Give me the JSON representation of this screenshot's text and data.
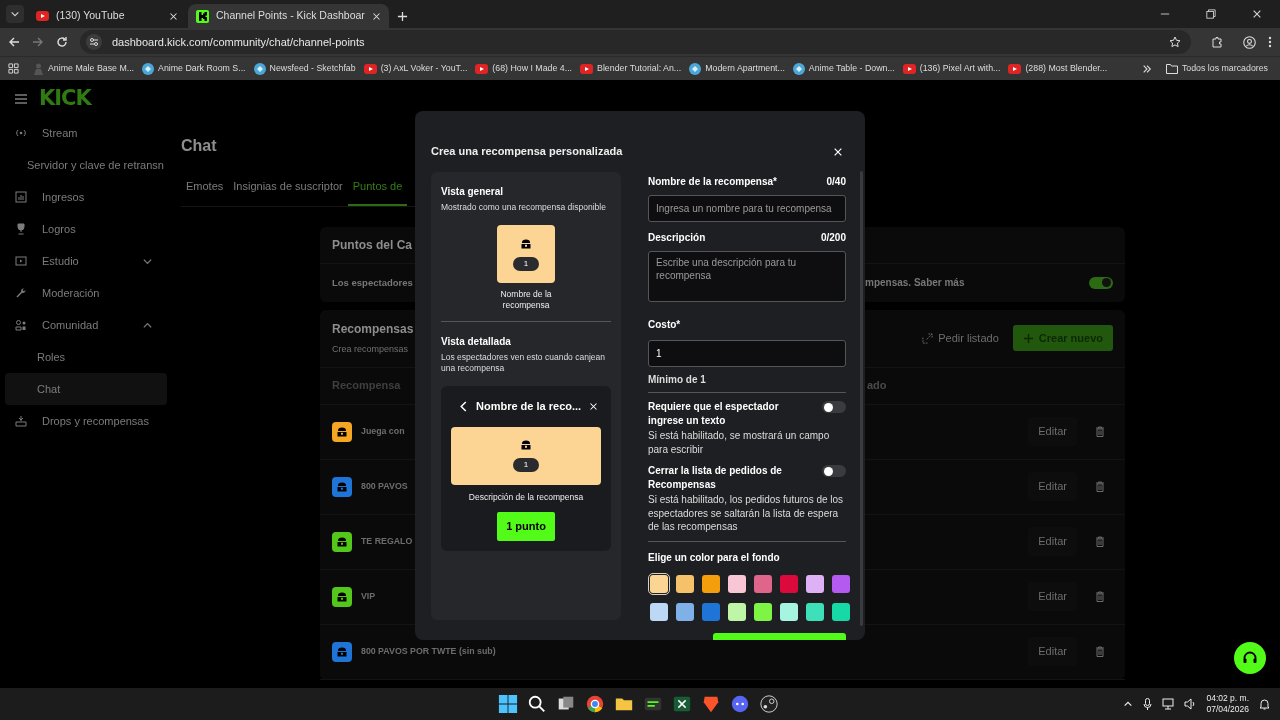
{
  "browser": {
    "tabs": [
      {
        "title": "(130) YouTube",
        "kind": "youtube",
        "selected": false
      },
      {
        "title": "Channel Points - Kick Dashboar",
        "kind": "kick",
        "selected": true
      }
    ],
    "address": "dashboard.kick.com/community/chat/channel-points",
    "bookmarks": [
      {
        "title": "Anime Male Base M...",
        "kind": "figure"
      },
      {
        "title": "Anime Dark Room S...",
        "kind": "site"
      },
      {
        "title": "Newsfeed - Sketchfab",
        "kind": "site"
      },
      {
        "title": "(3) AxL Voker - YouT...",
        "kind": "youtube"
      },
      {
        "title": "(68) How I Made 4...",
        "kind": "youtube"
      },
      {
        "title": "Blender Tutorial: An...",
        "kind": "youtube"
      },
      {
        "title": "Modern Apartment...",
        "kind": "site"
      },
      {
        "title": "Anime Table - Down...",
        "kind": "site"
      },
      {
        "title": "(136) Pixel Art with...",
        "kind": "youtube"
      },
      {
        "title": "(288) Most Blender...",
        "kind": "youtube"
      }
    ],
    "all_bookmarks": "Todos los marcadores"
  },
  "sidebar": {
    "logo": "KICK",
    "items": [
      {
        "label": "Stream",
        "selected": false,
        "children": [
          {
            "label": "Servidor y clave de retransn",
            "selected": false
          }
        ]
      },
      {
        "label": "Ingresos",
        "selected": false
      },
      {
        "label": "Logros",
        "selected": false
      },
      {
        "label": "Estudio",
        "selected": false,
        "expanded": false
      },
      {
        "label": "Moderación",
        "selected": false
      },
      {
        "label": "Comunidad",
        "selected": false,
        "expanded": true,
        "children": [
          {
            "label": "Roles",
            "selected": false
          },
          {
            "label": "Chat",
            "selected": true
          }
        ]
      },
      {
        "label": "Drops y recompensas",
        "selected": false
      }
    ]
  },
  "page": {
    "title": "Chat",
    "tabs": [
      {
        "label": "Emotes",
        "selected": false
      },
      {
        "label": "Insignias de suscriptor",
        "selected": false
      },
      {
        "label": "Puntos de",
        "selected": true
      }
    ],
    "channel_points": {
      "title": "Puntos del Ca",
      "text_left": "Los espectadores",
      "text_right": "mpensas. Saber más",
      "enabled": true
    },
    "rewards": {
      "title": "Recompensas",
      "subtitle": "Crea recompensas",
      "request_button": "Pedir listado",
      "create_button": "Crear nuevo",
      "columns": [
        "Recompensa",
        "ado"
      ],
      "rows": [
        {
          "name": "Juega con",
          "color": "#f5a623",
          "action": "Editar"
        },
        {
          "name": "800 PAVOS",
          "color": "#1f74d8",
          "action": "Editar"
        },
        {
          "name": "TE REGALO",
          "color": "#53c81a",
          "action": "Editar"
        },
        {
          "name": "VIP",
          "color": "#53c81a",
          "action": "Editar"
        },
        {
          "name": "800 PAVOS POR TWTE (sin sub)",
          "color": "#1f74d8",
          "action": "Editar"
        }
      ]
    }
  },
  "modal": {
    "title": "Crea una recompensa personalizada",
    "preview": {
      "general_title": "Vista general",
      "general_subtitle": "Mostrado como una recompensa disponible",
      "cost": "1",
      "name": "Nombre de la recompensa",
      "detail_title": "Vista detallada",
      "detail_subtitle": "Los espectadores ven esto cuando canjean una recompensa",
      "detail_heading": "Nombre de la reco...",
      "detail_cost": "1",
      "detail_description": "Descripción de la recompensa",
      "detail_button": "1 punto"
    },
    "form": {
      "name_label": "Nombre de la recompensa*",
      "name_counter": "0/40",
      "name_placeholder": "Ingresa un nombre para tu recompensa",
      "description_label": "Descripción",
      "description_counter": "0/200",
      "description_placeholder": "Escribe una descripción para tu recompensa",
      "cost_label": "Costo*",
      "cost_value": "1",
      "cost_hint": "Mínimo de 1",
      "toggles": [
        {
          "label": "Requiere que el espectador ingrese un texto",
          "help": "Si está habilitado, se mostrará un campo para escribir",
          "on": false
        },
        {
          "label": "Cerrar la lista de pedidos de Recompensas",
          "help": "Si está habilitado, los pedidos futuros de los espectadores se saltarán la lista de espera de las recompensas",
          "on": false
        }
      ],
      "color_label": "Elige un color para el fondo",
      "colors": [
        {
          "color": "#fcd595",
          "selected": true
        },
        {
          "color": "#f5c26b",
          "selected": false
        },
        {
          "color": "#f59e0b",
          "selected": false
        },
        {
          "color": "#f9c6d6",
          "selected": false
        },
        {
          "color": "#e0658a",
          "selected": false
        },
        {
          "color": "#dc0a3c",
          "selected": false
        },
        {
          "color": "#deb0f5",
          "selected": false
        },
        {
          "color": "#b55af0",
          "selected": false
        },
        {
          "color": "#bcd8f5",
          "selected": false
        },
        {
          "color": "#7fb0e8",
          "selected": false
        },
        {
          "color": "#1f74d8",
          "selected": false
        },
        {
          "color": "#bff5a6",
          "selected": false
        },
        {
          "color": "#7ef545",
          "selected": false
        },
        {
          "color": "#a6f5e0",
          "selected": false
        },
        {
          "color": "#3de0b8",
          "selected": false
        },
        {
          "color": "#17d9a8",
          "selected": false
        }
      ]
    }
  },
  "taskbar": {
    "time": "04:02 p. m.",
    "date": "07/04/2026"
  }
}
